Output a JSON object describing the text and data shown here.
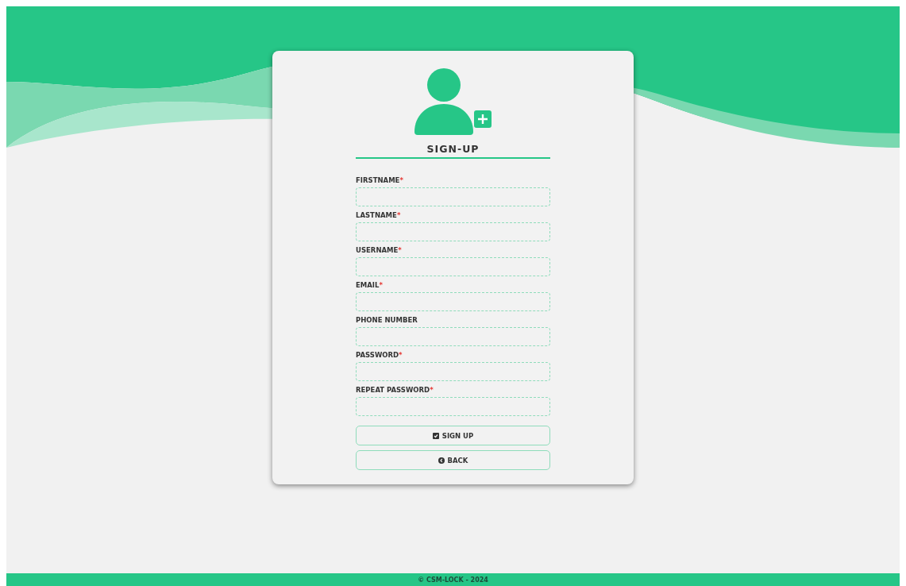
{
  "form": {
    "title": "SIGN-UP",
    "fields": [
      {
        "label": "FIRSTNAME",
        "required_mark": "*"
      },
      {
        "label": "LASTNAME",
        "required_mark": "*"
      },
      {
        "label": "USERNAME",
        "required_mark": "*"
      },
      {
        "label": "EMAIL",
        "required_mark": "*"
      },
      {
        "label": "PHONE NUMBER"
      },
      {
        "label": "PASSWORD",
        "required_mark": "*"
      },
      {
        "label": "REPEAT PASSWORD",
        "required_mark": "*"
      }
    ],
    "buttons": [
      {
        "label": "SIGN UP",
        "kind": "submit"
      },
      {
        "label": "BACK",
        "kind": "back"
      }
    ]
  },
  "footer": {
    "text": "© CSM-LOCK - 2024"
  }
}
